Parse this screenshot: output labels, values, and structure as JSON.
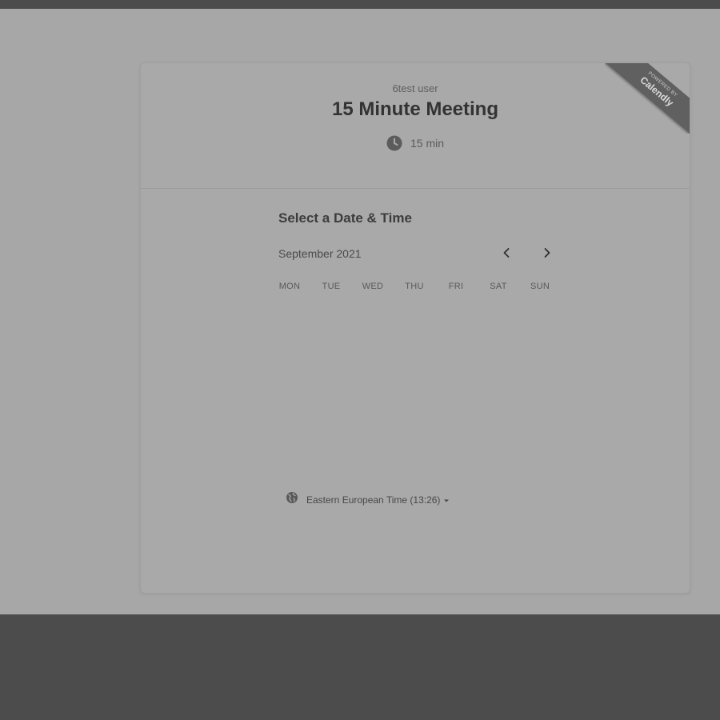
{
  "header": {
    "organizer": "6test user",
    "event_title": "15 Minute Meeting",
    "duration": "15 min",
    "duration_icon": "clock-icon"
  },
  "badge": {
    "powered_by": "POWERED BY",
    "brand": "Calendly"
  },
  "calendar": {
    "section_title": "Select a Date & Time",
    "month": "September 2021",
    "prev_icon": "chevron-left-icon",
    "next_icon": "chevron-right-icon",
    "weekdays": [
      "MON",
      "TUE",
      "WED",
      "THU",
      "FRI",
      "SAT",
      "SUN"
    ]
  },
  "timezone": {
    "icon": "globe-icon",
    "label": "Eastern European Time (13:26)",
    "dropdown_icon": "caret-down-icon"
  }
}
